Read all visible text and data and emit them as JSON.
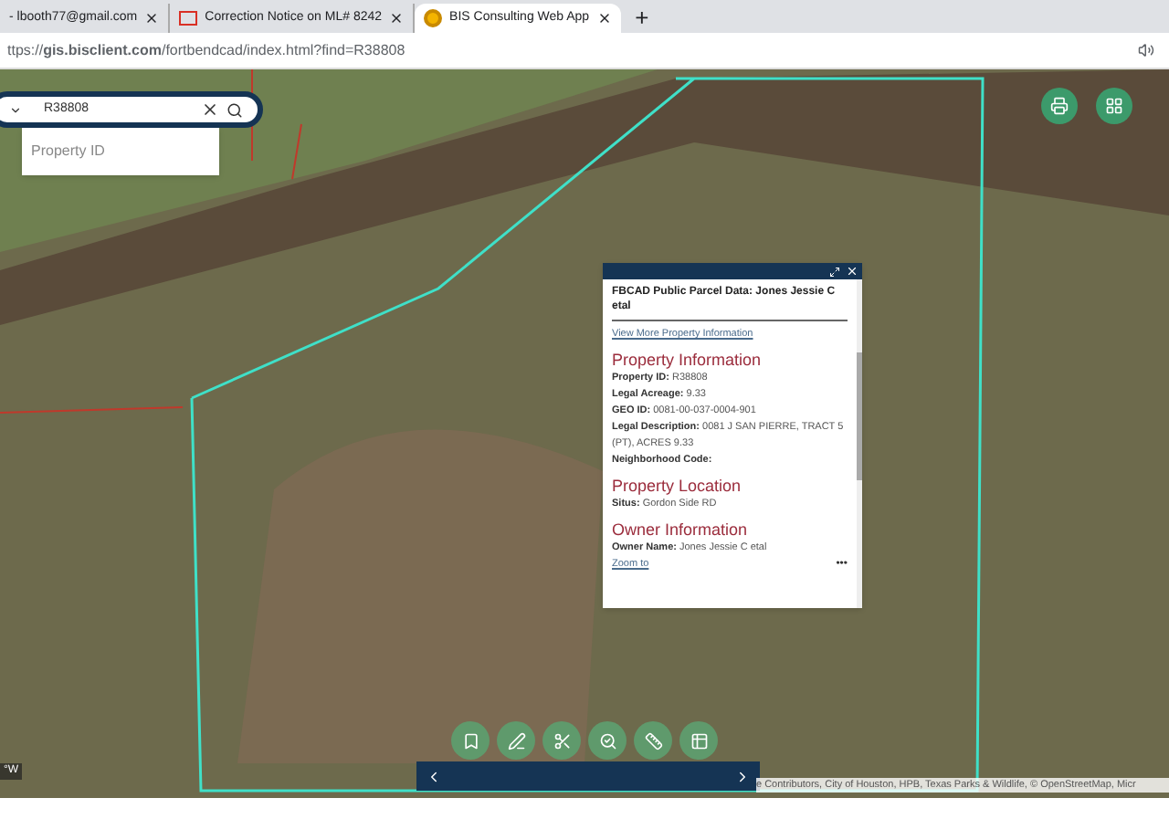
{
  "browser": {
    "tabs": [
      {
        "label": "- lbooth77@gmail.com",
        "selected": false,
        "kind": "plain"
      },
      {
        "label": "Correction Notice on ML# 8242",
        "selected": false,
        "kind": "mail"
      },
      {
        "label": "BIS Consulting Web App",
        "selected": true,
        "kind": "app"
      }
    ],
    "new_tab": "+",
    "address": "ttps://**gis.bisclient.com**/fortbendcad/index.html?find=R38808"
  },
  "search": {
    "value": "R38808",
    "dropdown_option": "Property ID"
  },
  "popup": {
    "title": "FBCAD Public Parcel Data: Jones Jessie C etal",
    "link": "View More Property Information",
    "sections": [
      {
        "heading": "Property Information",
        "fields": [
          {
            "label": "Property ID:",
            "value": "R38808"
          },
          {
            "label": "Legal Acreage:",
            "value": "9.33"
          },
          {
            "label": "GEO ID:",
            "value": "0081-00-037-0004-901"
          },
          {
            "label": "Legal Description:",
            "value": "0081 J SAN PIERRE, TRACT 5 (PT), ACRES 9.33"
          },
          {
            "label": "Neighborhood Code:"
          }
        ]
      },
      {
        "heading": "Property Location",
        "fields": [
          {
            "label": "Situs:",
            "value": "Gordon Side RD"
          }
        ]
      },
      {
        "heading": "Owner Information",
        "fields": [
          {
            "label": "Owner Name:",
            "value": "Jones Jessie C etal"
          }
        ]
      }
    ],
    "zoom_link": "Zoom to",
    "more": "•••"
  },
  "coordinates": "°W",
  "attribution": "e Contributors, City of Houston, HPB, Texas Parks & Wildlife, © OpenStreetMap, Micr"
}
